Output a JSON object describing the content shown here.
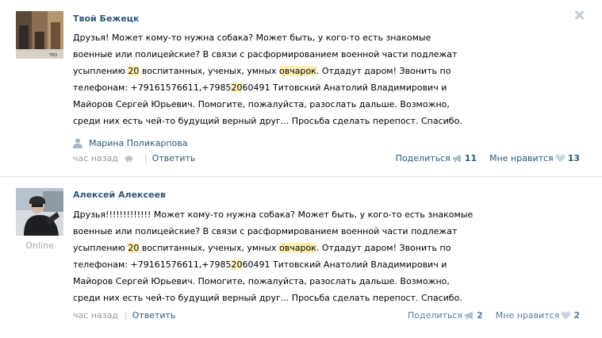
{
  "posts": [
    {
      "author": "Твой Бежецк",
      "text_lines": [
        "Друзья! Может кому-то нужна собака? Может быть, у кого-то есть знакомые",
        "военные или полицейские? В связи с расформированием военной части подлежат",
        [
          "усыплению ",
          "20",
          " воспитанных, ученых, умных ",
          "овчарок",
          ". Отдадут даром! Звонить по"
        ],
        [
          "телефонам: +79161576611,+7985",
          "20",
          "60491 Титовский Анатолий Владимирович и"
        ],
        "Майоров Сергей Юрьевич. Помогите, пожалуйста, разослать дальше. Возможно,",
        "среди них есть чей-то будущий верный друг... Просьба сделать перепост. Спасибо."
      ],
      "signer": "Марина Поликарпова",
      "time": "час назад",
      "reply": "Ответить",
      "share_label": "Поделиться",
      "share_count": "11",
      "like_label": "Мне нравится",
      "like_count": "13"
    },
    {
      "author": "Алексей Алексеев",
      "online": "Online",
      "text_lines": [
        "Друзья!!!!!!!!!!!!! Может кому-то нужна собака? Может быть, у кого-то есть знакомые",
        "военные или полицейские? В связи с расформированием военной части подлежат",
        [
          "усыплению ",
          "20",
          " воспитанных, ученых, умных ",
          "овчарок",
          ". Отдадут даром! Звонить по"
        ],
        [
          "телефонам: +79161576611,+7985",
          "20",
          "60491 Титовский Анатолий Владимирович и"
        ],
        "Майоров Сергей Юрьевич. Помогите, пожалуйста, разослать дальше. Возможно,",
        "среди них есть чей-то будущий верный друг... Просьба сделать перепост. Спасибо."
      ],
      "time": "час назад",
      "reply": "Ответить",
      "share_label": "Поделиться",
      "share_count": "2",
      "like_label": "Мне нравится",
      "like_count": "2"
    }
  ],
  "colors": {
    "link": "#2b587a",
    "highlight": "#fff0b3",
    "muted": "#999999",
    "divider": "#e4e8ed"
  },
  "icons": [
    "close-icon",
    "person-icon",
    "android-icon",
    "megaphone-icon",
    "heart-icon"
  ]
}
